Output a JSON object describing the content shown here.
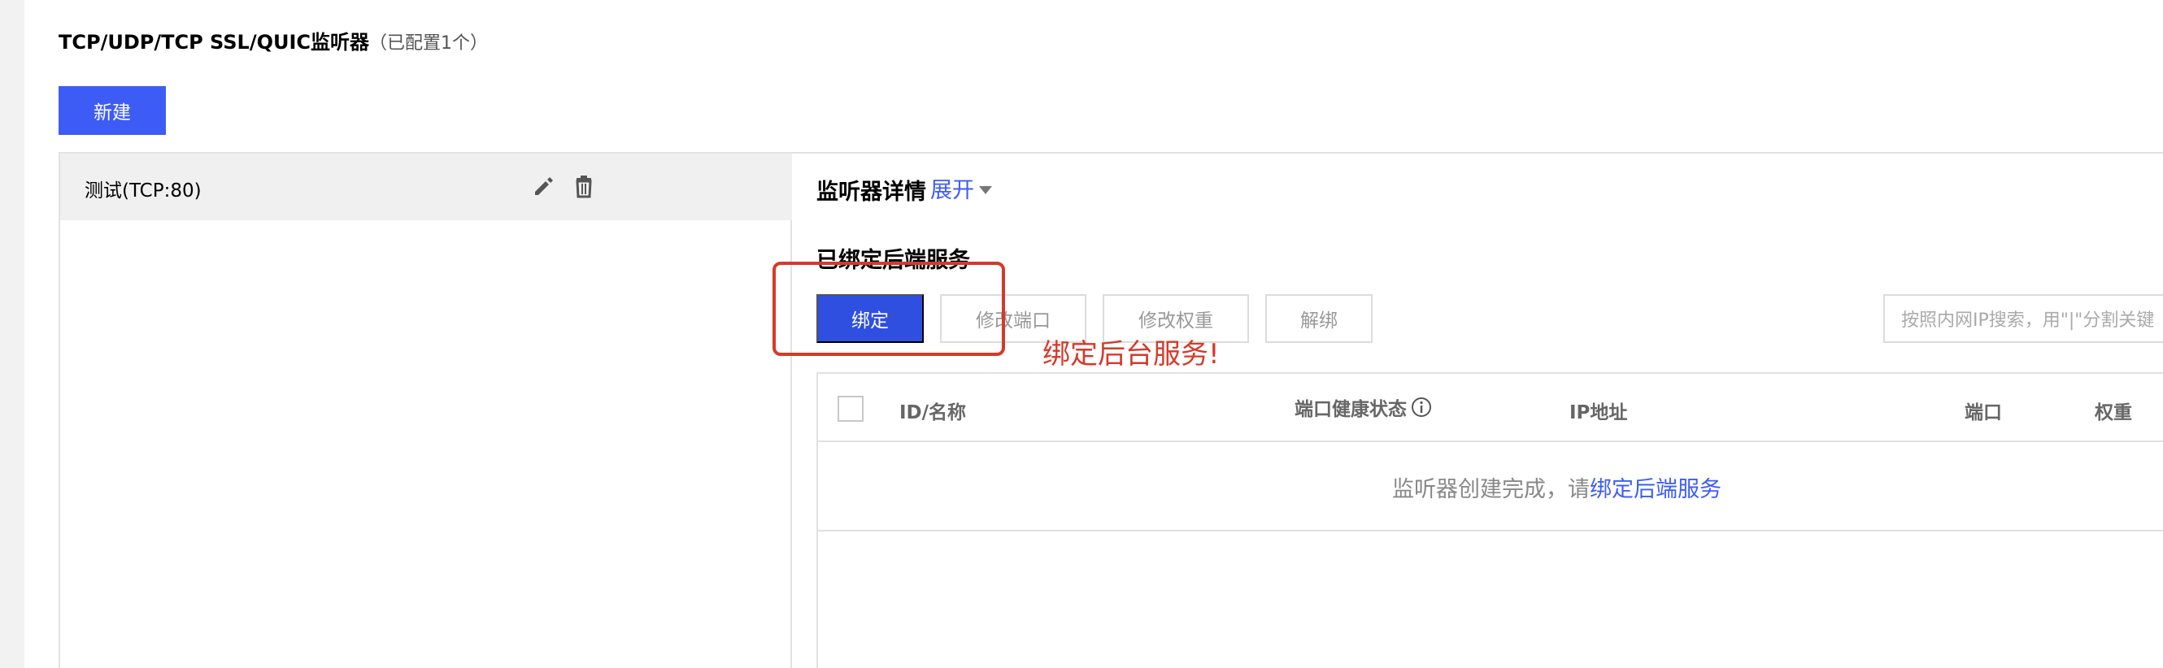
{
  "listener_section": {
    "title": "TCP/UDP/TCP SSL/QUIC监听器",
    "count_text": "（已配置1个）",
    "new_button": "新建"
  },
  "listeners": [
    {
      "name": "测试(TCP:80)",
      "edit_icon": "pencil-icon",
      "delete_icon": "trash-icon"
    }
  ],
  "detail": {
    "title": "监听器详情",
    "expand_label": "展开"
  },
  "bound_services": {
    "title": "已绑定后端服务",
    "buttons": {
      "bind": "绑定",
      "modify_port": "修改端口",
      "modify_weight": "修改权重",
      "unbind": "解绑"
    },
    "search_placeholder": "按照内网IP搜索，用\"|\"分割关键",
    "table": {
      "columns": [
        "ID/名称",
        "端口健康状态",
        "IP地址",
        "端口",
        "权重"
      ],
      "empty_text": "监听器创建完成，请",
      "empty_link": "绑定后端服务"
    }
  },
  "annotation": {
    "text": "绑定后台服务!",
    "color": "#d43a2a"
  },
  "colors": {
    "primary": "#3d5cf5",
    "annotation_red": "#d43a2a"
  }
}
